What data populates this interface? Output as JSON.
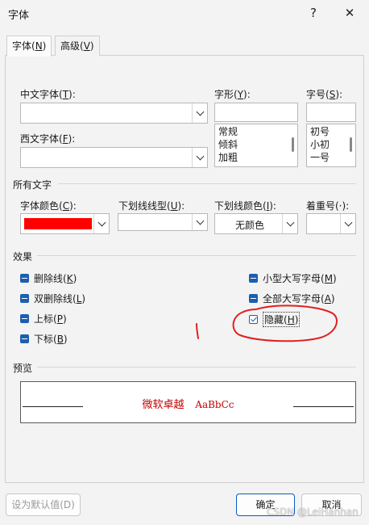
{
  "window": {
    "title": "字体",
    "help_label": "?",
    "close_label": "✕"
  },
  "tabs": [
    {
      "label_pre": "字体(",
      "key": "N",
      "label_post": ")"
    },
    {
      "label_pre": "高级(",
      "key": "V",
      "label_post": ")"
    }
  ],
  "font": {
    "chinese_label_pre": "中文字体(",
    "chinese_key": "T",
    "chinese_label_post": "):",
    "chinese_value": "",
    "western_label_pre": "西文字体(",
    "western_key": "F",
    "western_label_post": "):",
    "western_value": "",
    "style_label_pre": "字形(",
    "style_key": "Y",
    "style_label_post": "):",
    "style_value": "",
    "style_options": [
      "常规",
      "倾斜",
      "加粗"
    ],
    "size_label_pre": "字号(",
    "size_key": "S",
    "size_label_post": "):",
    "size_value": "",
    "size_options": [
      "初号",
      "小初",
      "一号"
    ]
  },
  "all_text": {
    "section_title": "所有文字",
    "color_label_pre": "字体颜色(",
    "color_key": "C",
    "color_label_post": "):",
    "color_value": "#ff0000",
    "underline_style_label_pre": "下划线线型(",
    "underline_style_key": "U",
    "underline_style_label_post": "):",
    "underline_color_label_pre": "下划线颜色(",
    "underline_color_key": "I",
    "underline_color_label_post": "):",
    "underline_color_value": "无颜色",
    "emphasis_label": "着重号(·):"
  },
  "effects": {
    "section_title": "效果",
    "left": [
      {
        "pre": "删除线(",
        "key": "K",
        "post": ")"
      },
      {
        "pre": "双删除线(",
        "key": "L",
        "post": ")"
      },
      {
        "pre": "上标(",
        "key": "P",
        "post": ")"
      },
      {
        "pre": "下标(",
        "key": "B",
        "post": ")"
      }
    ],
    "right": [
      {
        "pre": "小型大写字母(",
        "key": "M",
        "post": ")"
      },
      {
        "pre": "全部大写字母(",
        "key": "A",
        "post": ")"
      },
      {
        "pre": "隐藏(",
        "key": "H",
        "post": ")"
      }
    ],
    "hidden_checked": true,
    "annotation_color": "#e02020"
  },
  "preview": {
    "section_title": "预览",
    "sample_cn": "微软卓越",
    "sample_en": "AaBbCc"
  },
  "buttons": {
    "default_label": "设为默认值(D)",
    "ok_label": "确定",
    "cancel_label": "取消"
  },
  "watermark": "CSDN @LeiHanhan"
}
